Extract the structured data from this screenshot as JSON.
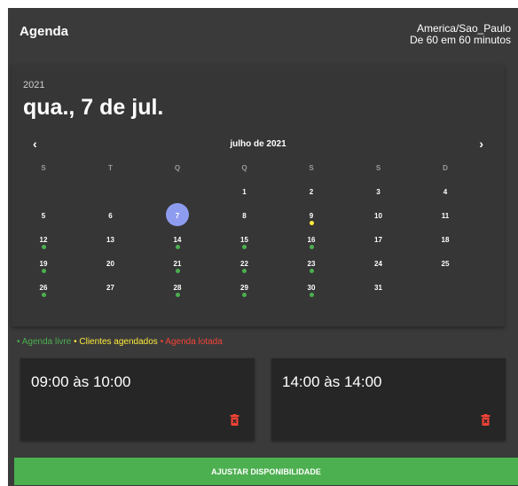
{
  "header": {
    "title": "Agenda",
    "timezone": "America/Sao_Paulo",
    "interval": "De 60 em 60 minutos"
  },
  "calendar": {
    "year": "2021",
    "selected_label": "qua., 7 de jul.",
    "month_label": "julho de 2021",
    "prev_icon": "‹",
    "next_icon": "›",
    "weekdays": [
      "S",
      "T",
      "Q",
      "Q",
      "S",
      "S",
      "D"
    ],
    "selected_day": 7,
    "first_weekday_index": 3,
    "days_in_month": 31,
    "day_status": {
      "9": "clientes",
      "12": "livre",
      "14": "livre",
      "15": "livre",
      "16": "livre",
      "19": "livre",
      "21": "livre",
      "22": "livre",
      "23": "livre",
      "26": "livre",
      "28": "livre",
      "29": "livre",
      "30": "livre"
    },
    "colors": {
      "livre": "#4caf50",
      "clientes": "#ffeb3b",
      "lotada": "#f44336",
      "selected": "#8e9cf0"
    }
  },
  "legend": [
    {
      "text": "• Agenda livre ",
      "color": "#4caf50"
    },
    {
      "text": "• Clientes agendados ",
      "color": "#ffeb3b"
    },
    {
      "text": "• Agenda lotada",
      "color": "#f44336"
    }
  ],
  "slots": [
    {
      "label": "09:00 às 10:00",
      "delete_icon": "trash-icon"
    },
    {
      "label": "14:00 às 14:00",
      "delete_icon": "trash-icon"
    }
  ],
  "action_button": {
    "label": "AJUSTAR DISPONIBILIDADE",
    "color": "#4caf50"
  }
}
